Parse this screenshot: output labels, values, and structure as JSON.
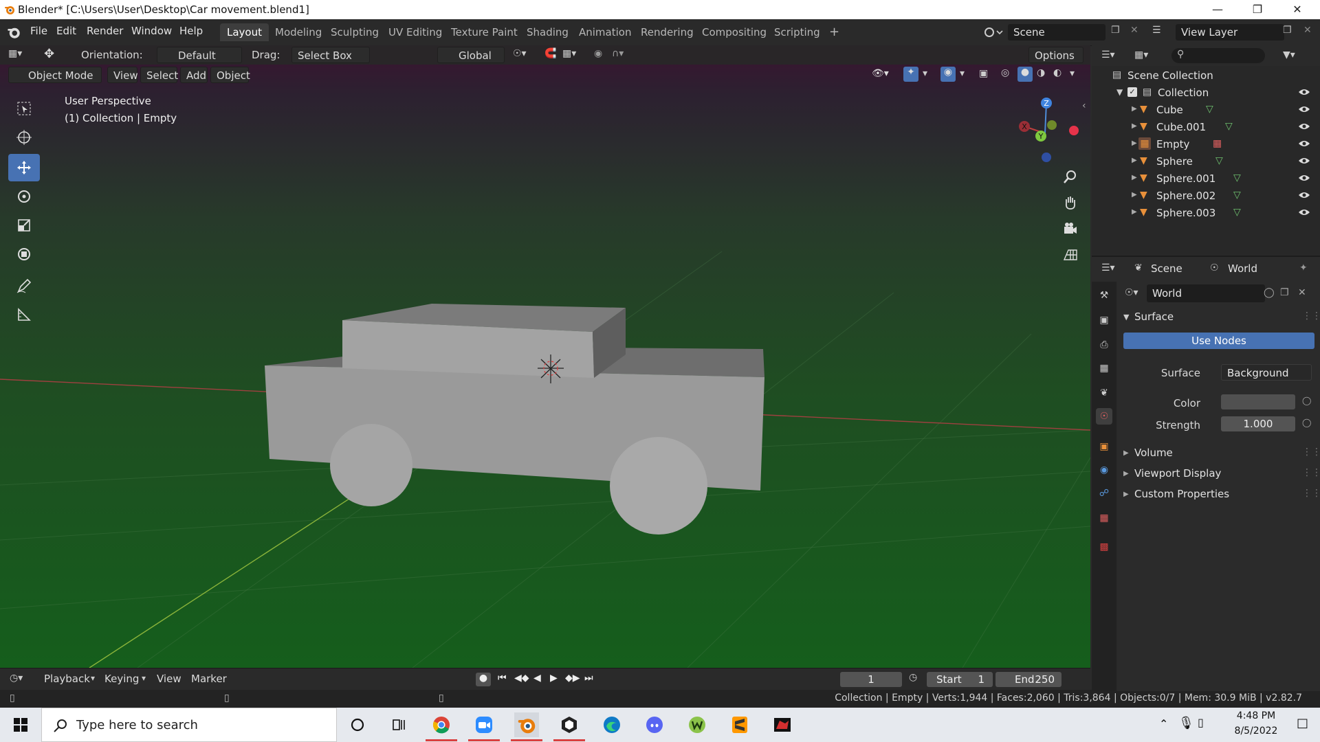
{
  "window": {
    "title": "Blender* [C:\\Users\\User\\Desktop\\Car movement.blend1]"
  },
  "menu": [
    "File",
    "Edit",
    "Render",
    "Window",
    "Help"
  ],
  "workspaces": [
    "Layout",
    "Modeling",
    "Sculpting",
    "UV Editing",
    "Texture Paint",
    "Shading",
    "Animation",
    "Rendering",
    "Compositing",
    "Scripting"
  ],
  "topright": {
    "scene": "Scene",
    "view_layer": "View Layer"
  },
  "tool_header": {
    "orientation_label": "Orientation:",
    "orientation_value": "Default",
    "drag_label": "Drag:",
    "drag_value": "Select Box",
    "transform_value": "Global",
    "options": "Options"
  },
  "viewport_header": {
    "mode": "Object Mode",
    "view": "View",
    "select": "Select",
    "add": "Add",
    "object": "Object"
  },
  "viewport_info": {
    "line1": "User Perspective",
    "line2": "(1) Collection | Empty"
  },
  "gizmo": {
    "z": "Z",
    "y": "Y",
    "x": "X"
  },
  "outliner": {
    "root": "Scene Collection",
    "collection": "Collection",
    "items": [
      "Cube",
      "Cube.001",
      "Empty",
      "Sphere",
      "Sphere.001",
      "Sphere.002",
      "Sphere.003"
    ]
  },
  "properties": {
    "scene_tab": "Scene",
    "world_tab": "World",
    "world_name": "World",
    "surface_panel": "Surface",
    "use_nodes": "Use Nodes",
    "surface_label": "Surface",
    "surface_value": "Background",
    "color_label": "Color",
    "strength_label": "Strength",
    "strength_value": "1.000",
    "color_hex": "#505050",
    "panels": [
      "Volume",
      "Viewport Display",
      "Custom Properties"
    ]
  },
  "timeline": {
    "playback": "Playback",
    "keying": "Keying",
    "view": "View",
    "marker": "Marker",
    "current_frame": "1",
    "start_label": "Start",
    "start": "1",
    "end_label": "End",
    "end": "250"
  },
  "status": "Collection | Empty | Verts:1,944 | Faces:2,060 | Tris:3,864 | Objects:0/7 | Mem: 30.9 MiB | v2.82.7",
  "taskbar": {
    "search_placeholder": "Type here to search",
    "time": "4:48 PM",
    "date": "8/5/2022"
  },
  "colors": {
    "accent": "#4772b3",
    "selected_tool": "#4772b3"
  }
}
